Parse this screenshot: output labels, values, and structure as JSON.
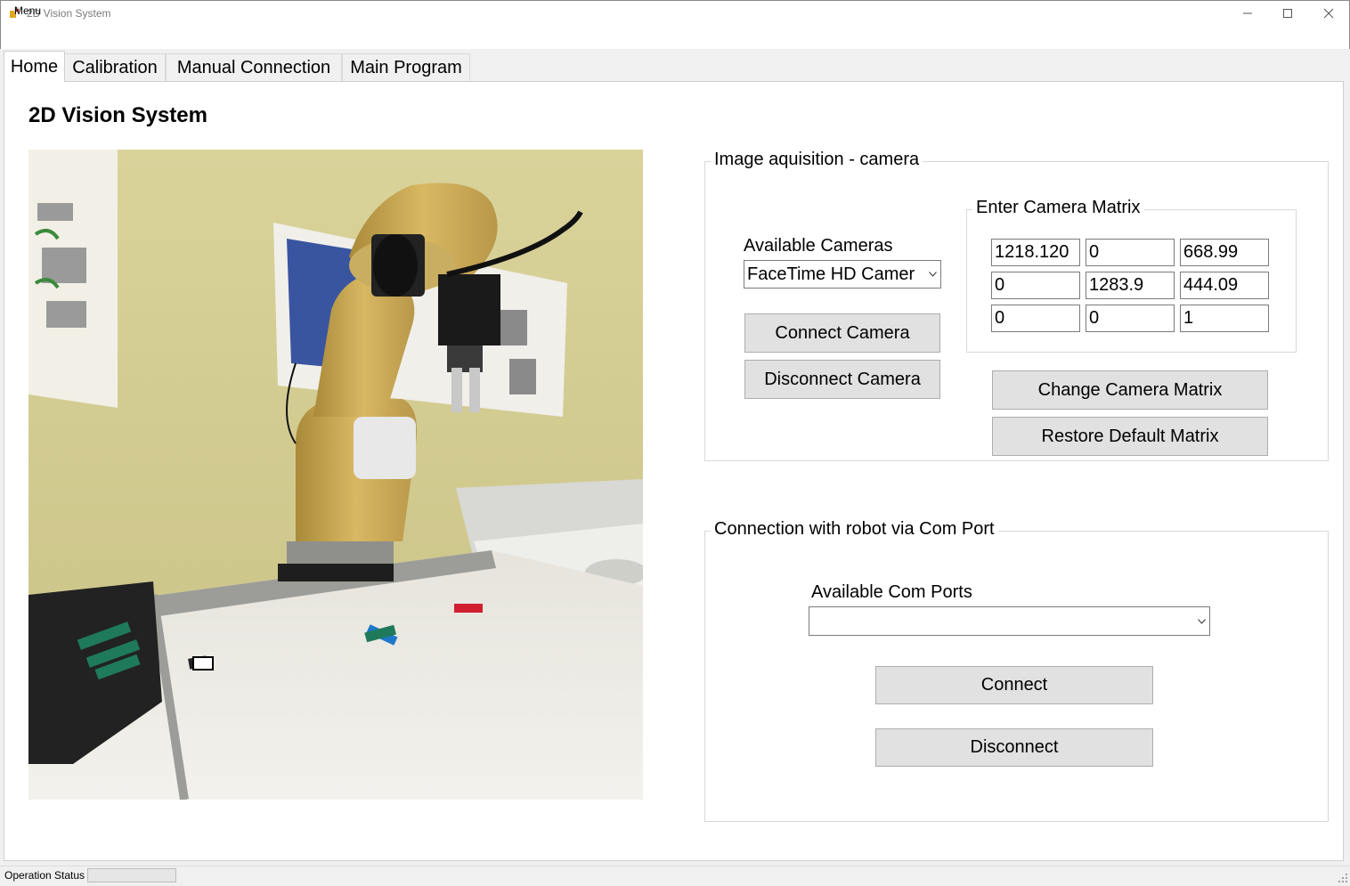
{
  "window": {
    "title": "2D Vision System",
    "icon": "app-logo-icon",
    "controls": [
      "minimize-icon",
      "maximize-icon",
      "close-icon"
    ]
  },
  "menu": {
    "label": "Menu"
  },
  "tabs": [
    {
      "label": "Home",
      "active": true
    },
    {
      "label": "Calibration",
      "active": false
    },
    {
      "label": "Manual Connection",
      "active": false
    },
    {
      "label": "Main Program",
      "active": false
    }
  ],
  "home": {
    "title": "2D Vision System",
    "image_acquisition": {
      "legend": "Image aquisition - camera",
      "cameras_label": "Available Cameras",
      "camera_selected": "FaceTime HD Camer",
      "connect_label": "Connect Camera",
      "disconnect_label": "Disconnect Camera",
      "matrix": {
        "legend": "Enter Camera Matrix",
        "rows": [
          [
            "1218.120",
            "0",
            "668.99"
          ],
          [
            "0",
            "1283.9",
            "444.09"
          ],
          [
            "0",
            "0",
            "1"
          ]
        ]
      },
      "change_matrix_label": "Change Camera Matrix",
      "restore_matrix_label": "Restore Default Matrix"
    },
    "robot_connection": {
      "legend": "Connection with robot via Com Port",
      "com_ports_label": "Available Com Ports",
      "com_port_selected": "",
      "connect_label": "Connect",
      "disconnect_label": "Disconnect"
    }
  },
  "status_bar": {
    "label": "Operation Status",
    "progress": 0
  },
  "colors": {
    "button_face": "#e1e1e1",
    "window_bg": "#f0f0f0",
    "panel_bg": "#ffffff",
    "progress_fill": "#06b025"
  }
}
